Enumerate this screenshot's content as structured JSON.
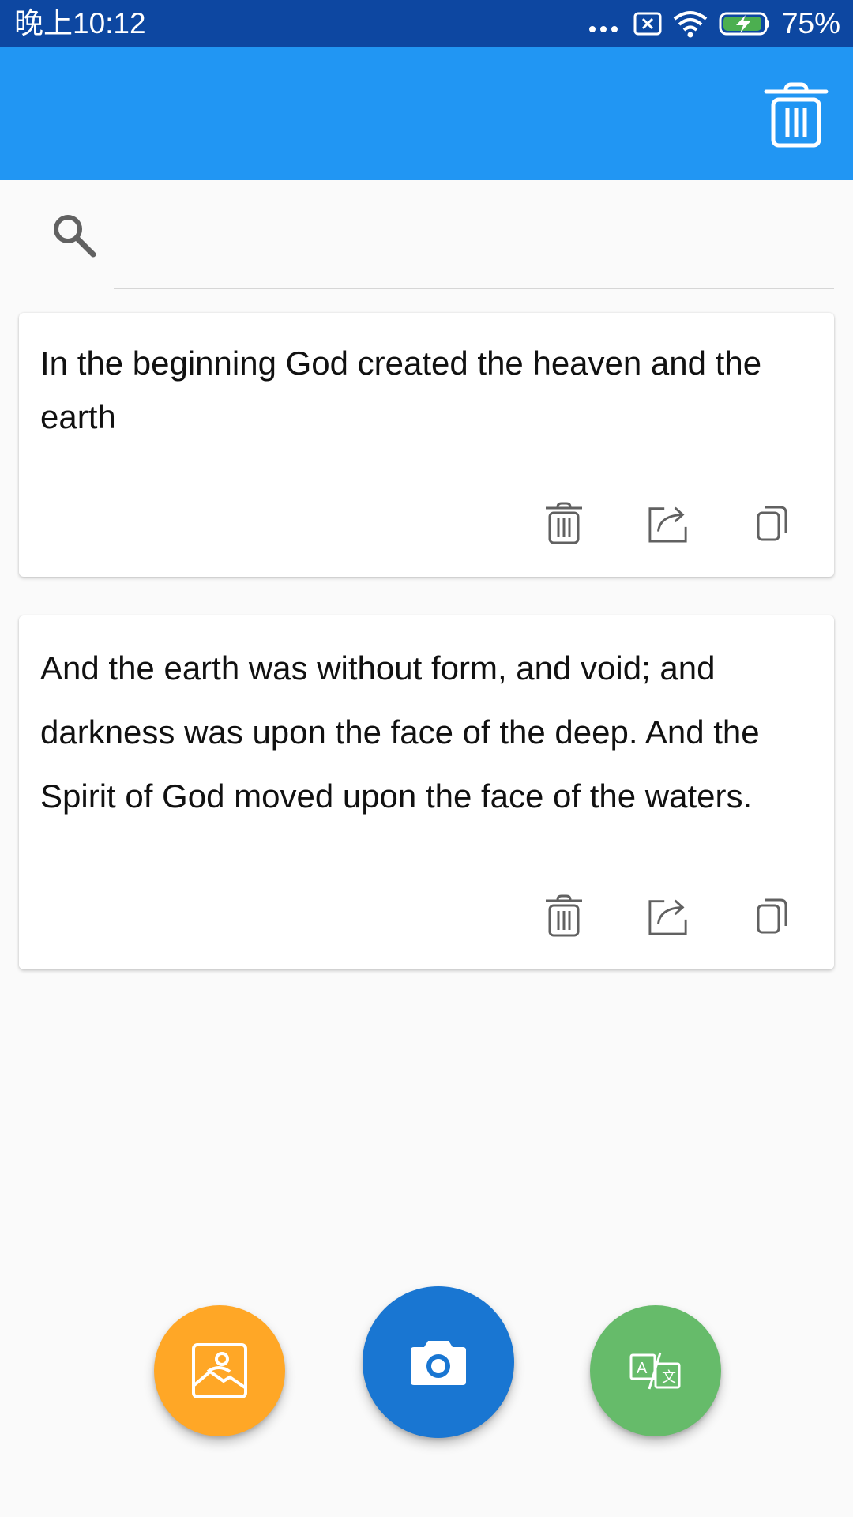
{
  "status_bar": {
    "time": "晚上10:12",
    "battery_percent": "75%"
  },
  "toolbar": {
    "clear_all_icon": "trash-icon"
  },
  "search": {
    "value": "",
    "placeholder": ""
  },
  "notes": [
    {
      "text": "In the beginning God created the heaven and the earth"
    },
    {
      "text": "And the earth was without form, and void; and darkness was upon the face of the deep. And the Spirit of God moved upon the face of the waters."
    }
  ],
  "fabs": {
    "gallery_icon": "image-icon",
    "camera_icon": "camera-icon",
    "translate_icon": "translate-icon"
  },
  "colors": {
    "status_bar": "#0d47a1",
    "app_bar": "#2196f3",
    "fab_gallery": "#ffa726",
    "fab_camera": "#1976d2",
    "fab_translate": "#66bb6a"
  }
}
